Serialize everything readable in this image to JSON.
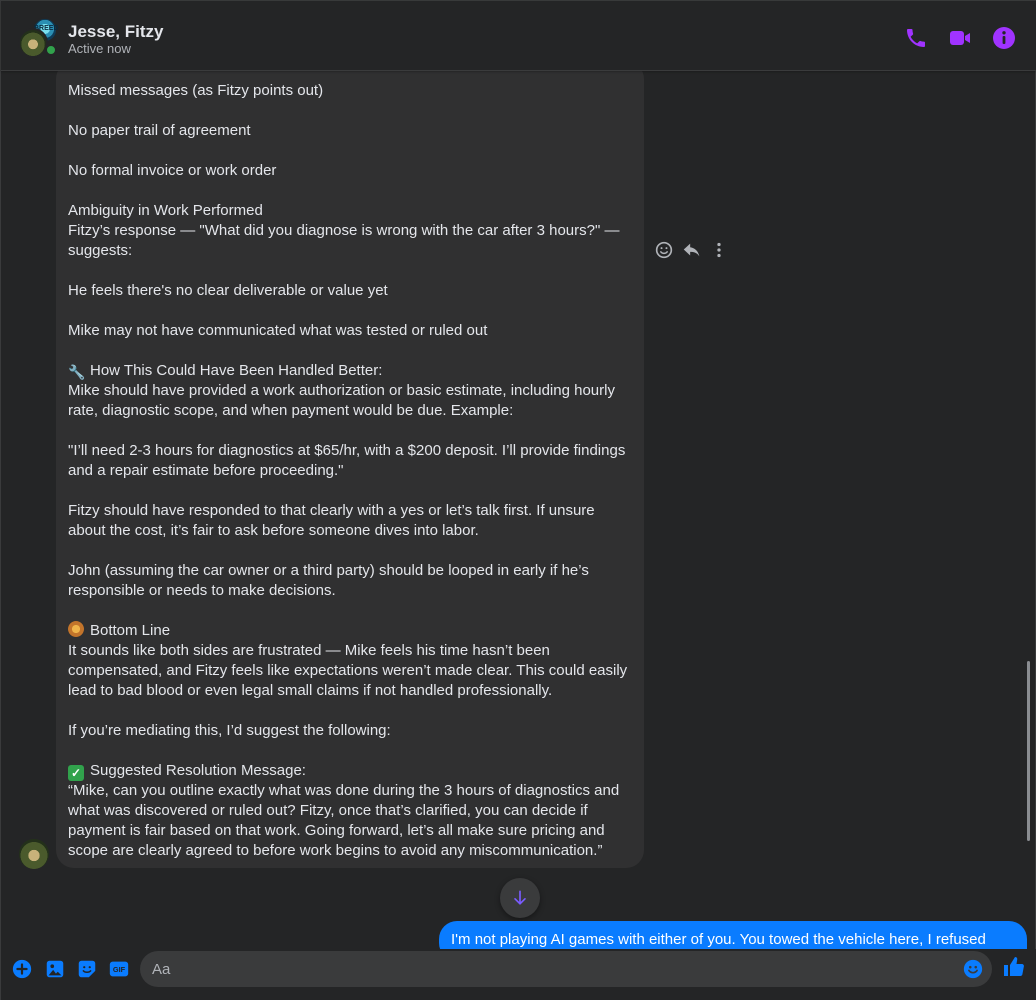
{
  "conversation": {
    "title": "Jesse, Fitzy",
    "status": "Active now",
    "accent_color": "#a033ff",
    "online_color": "#31a24c"
  },
  "header_actions": [
    {
      "name": "phone-call-icon"
    },
    {
      "name": "video-call-icon"
    },
    {
      "name": "info-icon"
    }
  ],
  "message": {
    "paragraphs": [
      "Missed messages (as Fitzy points out)",
      "No paper trail of agreement",
      "No formal invoice or work order",
      "Ambiguity in Work Performed\nFitzy’s response — \"What did you diagnose is wrong with the car after 3 hours?\" — suggests:",
      "He feels there's no clear deliverable or value yet",
      "Mike may not have communicated what was tested or ruled out",
      "How This Could Have Been Handled Better:\nMike should have provided a work authorization or basic estimate, including hourly rate, diagnostic scope, and when payment would be due. Example:",
      "\"I’ll need 2-3 hours for diagnostics at $65/hr, with a $200 deposit. I’ll provide findings and a repair estimate before proceeding.\"",
      "Fitzy should have responded to that clearly with a yes or let’s talk first. If unsure about the cost, it’s fair to ask before someone dives into labor.",
      "John (assuming the car owner or a third party) should be looped in early if he’s responsible or needs to make decisions.",
      "Bottom Line\nIt sounds like both sides are frustrated — Mike feels his time hasn’t been compensated, and Fitzy feels like expectations weren’t made clear. This could easily lead to bad blood or even legal small claims if not handled professionally.",
      "If you’re mediating this, I’d suggest the following:",
      "Suggested Resolution Message:\n“Mike, can you outline exactly what was done during the 3 hours of diagnostics and what was discovered or ruled out? Fitzy, once that’s clarified, you can decide if payment is fair based on that work. Going forward, let’s all make sure pricing and scope are clearly agreed to before work begins to avoid any miscommunication.”"
    ],
    "emoji": {
      "p6": "wrench-icon",
      "p10": "pie-icon",
      "p12": "check-mark-icon"
    }
  },
  "hover_actions": [
    {
      "name": "react-icon"
    },
    {
      "name": "reply-icon"
    },
    {
      "name": "more-icon"
    }
  ],
  "outgoing": {
    "text": "I'm not playing AI games with either of you. You towed the vehicle here, I refused",
    "color": "#0a7cff"
  },
  "composer": {
    "placeholder": "Aa",
    "icons": [
      "add-icon",
      "photo-icon",
      "sticker-icon",
      "gif-icon",
      "emoji-icon",
      "thumbs-up-icon"
    ],
    "gif_label": "GIF",
    "accent_color": "#0a7cff"
  }
}
